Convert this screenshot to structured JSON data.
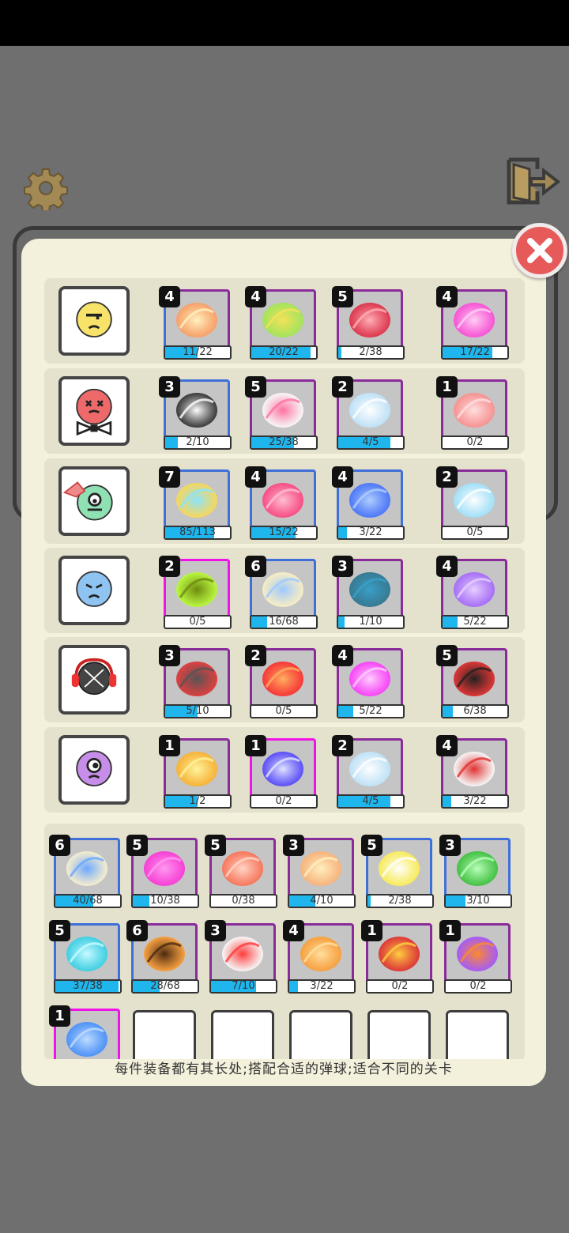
{
  "footer": {
    "tip": "每件装备都有其长处;搭配合适的弹球;适合不同的关卡"
  },
  "ball_rows": [
    {
      "ball": "yellow-face-ball",
      "items": [
        {
          "level": "4",
          "progress": "11/22",
          "ratio": 0.5,
          "icon": "orange-ring-burst-icon",
          "border": "mix"
        },
        {
          "level": "4",
          "progress": "20/22",
          "ratio": 0.91,
          "icon": "green-tornado-icon",
          "border": "purple"
        },
        {
          "level": "5",
          "progress": "2/38",
          "ratio": 0.05,
          "icon": "red-spike-burst-icon",
          "border": "purple"
        },
        {
          "level": "4",
          "progress": "17/22",
          "ratio": 0.77,
          "icon": "pink-pinwheel-icon",
          "border": "purple"
        }
      ]
    },
    {
      "ball": "red-bowtie-ball",
      "items": [
        {
          "level": "3",
          "progress": "2/10",
          "ratio": 0.2,
          "icon": "bowtie-icon",
          "border": "blue"
        },
        {
          "level": "5",
          "progress": "25/38",
          "ratio": 0.66,
          "icon": "cow-slash-icon",
          "border": "purple"
        },
        {
          "level": "2",
          "progress": "4/5",
          "ratio": 0.8,
          "icon": "bubble-rings-icon",
          "border": "purple"
        },
        {
          "level": "1",
          "progress": "0/2",
          "ratio": 0,
          "icon": "crescent-slash-icon",
          "border": "purple"
        }
      ]
    },
    {
      "ball": "green-bandana-ball",
      "items": [
        {
          "level": "7",
          "progress": "85/113",
          "ratio": 0.75,
          "icon": "chick-blast-icon",
          "border": "blue"
        },
        {
          "level": "4",
          "progress": "15/22",
          "ratio": 0.68,
          "icon": "pink-leaf-icon",
          "border": "blue"
        },
        {
          "level": "4",
          "progress": "3/22",
          "ratio": 0.14,
          "icon": "blue-wave-icon",
          "border": "blue"
        },
        {
          "level": "2",
          "progress": "0/5",
          "ratio": 0,
          "icon": "ice-flame-icon",
          "border": "purple"
        }
      ]
    },
    {
      "ball": "blue-sad-ball",
      "items": [
        {
          "level": "2",
          "progress": "0/5",
          "ratio": 0,
          "icon": "green-grid-icon",
          "border": "pink"
        },
        {
          "level": "6",
          "progress": "16/68",
          "ratio": 0.24,
          "icon": "striped-egg-icon",
          "border": "blue"
        },
        {
          "level": "3",
          "progress": "1/10",
          "ratio": 0.1,
          "icon": "boomerang-icon",
          "border": "purple"
        },
        {
          "level": "4",
          "progress": "5/22",
          "ratio": 0.23,
          "icon": "purple-laser-icon",
          "border": "purple"
        }
      ]
    },
    {
      "ball": "headphone-ball",
      "items": [
        {
          "level": "3",
          "progress": "5/10",
          "ratio": 0.5,
          "icon": "headphones-icon",
          "border": "purple"
        },
        {
          "level": "2",
          "progress": "0/5",
          "ratio": 0,
          "icon": "red-explosion-icon",
          "border": "purple"
        },
        {
          "level": "4",
          "progress": "5/22",
          "ratio": 0.23,
          "icon": "magenta-blast-icon",
          "border": "purple"
        },
        {
          "level": "5",
          "progress": "6/38",
          "ratio": 0.16,
          "icon": "dynamite-icon",
          "border": "purple"
        }
      ]
    },
    {
      "ball": "purple-cyclops-ball",
      "items": [
        {
          "level": "1",
          "progress": "1/2",
          "ratio": 0.5,
          "icon": "yellow-claw-icon",
          "border": "purple"
        },
        {
          "level": "1",
          "progress": "0/2",
          "ratio": 0,
          "icon": "blue-claws-icon",
          "border": "pink"
        },
        {
          "level": "2",
          "progress": "4/5",
          "ratio": 0.8,
          "icon": "ice-ring-icon",
          "border": "purple"
        },
        {
          "level": "4",
          "progress": "3/22",
          "ratio": 0.14,
          "icon": "rocket-icon",
          "border": "purple"
        }
      ]
    }
  ],
  "equipment": [
    {
      "level": "6",
      "progress": "40/68",
      "ratio": 0.59,
      "icon": "lightning-egg-icon",
      "border": "blue"
    },
    {
      "level": "5",
      "progress": "10/38",
      "ratio": 0.26,
      "icon": "pink-heart-icon",
      "border": "purple"
    },
    {
      "level": "5",
      "progress": "0/38",
      "ratio": 0,
      "icon": "pilot-character-icon",
      "border": "purple"
    },
    {
      "level": "3",
      "progress": "4/10",
      "ratio": 0.4,
      "icon": "fire-tornado-icon",
      "border": "purple"
    },
    {
      "level": "5",
      "progress": "2/38",
      "ratio": 0.05,
      "icon": "battery-icon",
      "border": "blue"
    },
    {
      "level": "3",
      "progress": "3/10",
      "ratio": 0.3,
      "icon": "clover-icon",
      "border": "blue"
    },
    {
      "level": "5",
      "progress": "37/38",
      "ratio": 0.97,
      "icon": "cyan-scythe-icon",
      "border": "blue"
    },
    {
      "level": "6",
      "progress": "28/68",
      "ratio": 0.41,
      "icon": "spike-burst-icon",
      "border": "mix"
    },
    {
      "level": "3",
      "progress": "7/10",
      "ratio": 0.7,
      "icon": "mini-rocket-icon",
      "border": "purple"
    },
    {
      "level": "4",
      "progress": "3/22",
      "ratio": 0.14,
      "icon": "fire-slash-icon",
      "border": "purple"
    },
    {
      "level": "1",
      "progress": "0/2",
      "ratio": 0,
      "icon": "red-robot-icon",
      "border": "purple"
    },
    {
      "level": "1",
      "progress": "0/2",
      "ratio": 0,
      "icon": "violet-fire-icon",
      "border": "purple"
    },
    {
      "level": "1",
      "progress": "",
      "ratio": 0,
      "icon": "blue-lightning-icon",
      "border": "pink"
    }
  ],
  "colors": {
    "accent_bar": "#1fb6ee",
    "close_button": "#e65a5a",
    "panel": "#f3f0dc"
  }
}
